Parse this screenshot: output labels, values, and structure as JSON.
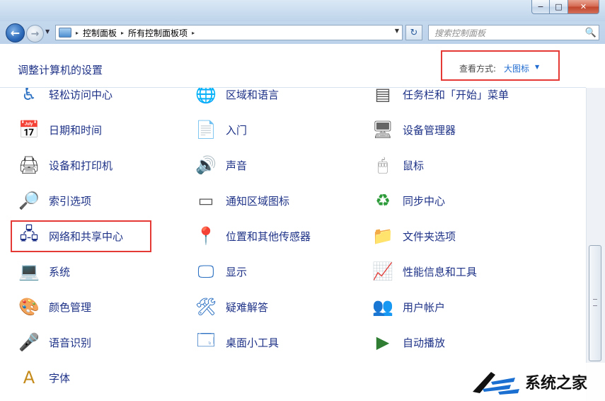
{
  "window": {
    "minimize_label": "−",
    "maximize_label": "□",
    "close_label": "✕"
  },
  "navbar": {
    "back_label": "←",
    "forward_label": "→",
    "recent_label": "▼",
    "breadcrumb": [
      "控制面板",
      "所有控制面板项"
    ],
    "breadcrumb_sep": "▸",
    "address_dropdown": "▼",
    "refresh_label": "↻",
    "search_placeholder": "搜索控制面板",
    "search_icon": "🔍"
  },
  "header": {
    "title": "调整计算机的设置",
    "view_label": "查看方式:",
    "view_value": "大图标",
    "view_caret": "▼"
  },
  "items": [
    {
      "label": "轻松访问中心",
      "icon": "♿",
      "icon_name": "ease-of-access-icon"
    },
    {
      "label": "区域和语言",
      "icon": "🌐",
      "icon_name": "region-language-icon"
    },
    {
      "label": "任务栏和「开始」菜单",
      "icon": "▤",
      "icon_name": "taskbar-icon"
    },
    {
      "label": "日期和时间",
      "icon": "📅",
      "icon_name": "date-time-icon"
    },
    {
      "label": "入门",
      "icon": "📄",
      "icon_name": "getting-started-icon"
    },
    {
      "label": "设备管理器",
      "icon": "🖥",
      "icon_name": "device-manager-icon"
    },
    {
      "label": "设备和打印机",
      "icon": "🖨",
      "icon_name": "printer-icon"
    },
    {
      "label": "声音",
      "icon": "🔊",
      "icon_name": "sound-icon"
    },
    {
      "label": "鼠标",
      "icon": "🖱",
      "icon_name": "mouse-icon"
    },
    {
      "label": "索引选项",
      "icon": "🔎",
      "icon_name": "indexing-icon"
    },
    {
      "label": "通知区域图标",
      "icon": "▭",
      "icon_name": "notification-area-icon"
    },
    {
      "label": "同步中心",
      "icon": "♻",
      "icon_name": "sync-center-icon"
    },
    {
      "label": "网络和共享中心",
      "icon": "🖧",
      "icon_name": "network-icon"
    },
    {
      "label": "位置和其他传感器",
      "icon": "📍",
      "icon_name": "location-sensor-icon"
    },
    {
      "label": "文件夹选项",
      "icon": "📁",
      "icon_name": "folder-options-icon"
    },
    {
      "label": "系统",
      "icon": "💻",
      "icon_name": "system-icon"
    },
    {
      "label": "显示",
      "icon": "🖵",
      "icon_name": "display-icon"
    },
    {
      "label": "性能信息和工具",
      "icon": "📈",
      "icon_name": "performance-icon"
    },
    {
      "label": "颜色管理",
      "icon": "🎨",
      "icon_name": "color-management-icon"
    },
    {
      "label": "疑难解答",
      "icon": "🛠",
      "icon_name": "troubleshooting-icon"
    },
    {
      "label": "用户帐户",
      "icon": "👥",
      "icon_name": "user-accounts-icon"
    },
    {
      "label": "语音识别",
      "icon": "🎤",
      "icon_name": "speech-recognition-icon"
    },
    {
      "label": "桌面小工具",
      "icon": "🗔",
      "icon_name": "gadgets-icon"
    },
    {
      "label": "自动播放",
      "icon": "▶",
      "icon_name": "autoplay-icon"
    },
    {
      "label": "字体",
      "icon": "A",
      "icon_name": "fonts-icon"
    }
  ],
  "watermark": {
    "text": "系统之家"
  }
}
